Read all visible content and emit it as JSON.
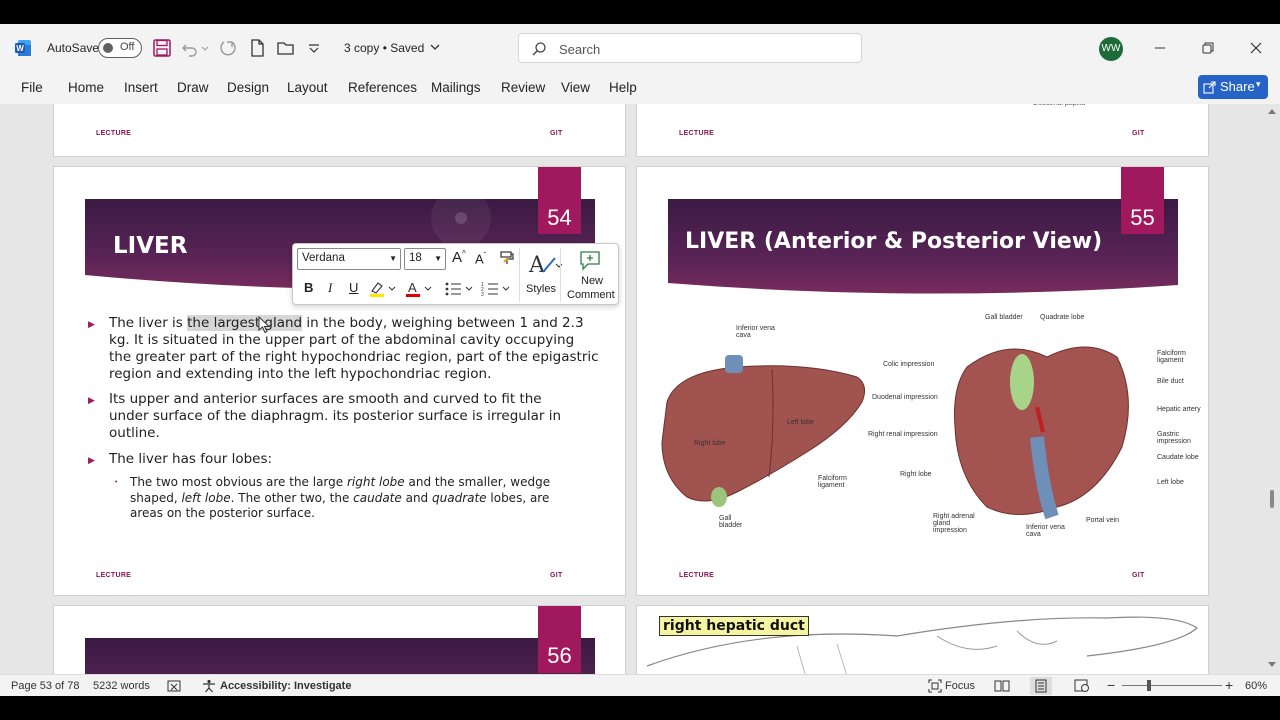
{
  "titlebar": {
    "autosave_label": "AutoSave",
    "autosave_state": "Off",
    "doc_title": "3 copy • Saved",
    "search_placeholder": "Search",
    "user_initials": "WW"
  },
  "menu": {
    "items": [
      "File",
      "Home",
      "Insert",
      "Draw",
      "Design",
      "Layout",
      "References",
      "Mailings",
      "Review",
      "View",
      "Help"
    ],
    "share_label": "Share"
  },
  "pages": {
    "top_left": {
      "footer_left": "LECTURE",
      "footer_right": "GIT"
    },
    "top_right": {
      "footer_left": "LECTURE",
      "footer_right": "GIT"
    },
    "slide54": {
      "number": "54",
      "title": "LIVER",
      "bullets": [
        {
          "pre": "The liver is ",
          "sel": "the largest gland",
          "post": " in the body, weighing between 1 and 2.3 kg. It is situated in the upper part of the abdominal cavity occupying the greater part of the right hypochondriac region, part of the epigastric region and extending into the left hypochondriac region."
        },
        {
          "text": "Its upper and anterior surfaces are smooth and curved to fit the under surface of the diaphragm. its posterior surface is irregular in outline."
        },
        {
          "text": "The liver has four lobes:"
        }
      ],
      "sub_bullet": {
        "p1": "The two most obvious are the large ",
        "i1": "right lobe",
        "p2": " and the smaller, wedge shaped, ",
        "i2": "left lobe",
        "p3": ". The other two, the ",
        "i3": "caudate",
        "p4": " and ",
        "i4": "quadrate",
        "p5": " lobes, are areas on the posterior surface."
      },
      "footer_left": "LECTURE",
      "footer_right": "GIT"
    },
    "slide55": {
      "number": "55",
      "title": "LIVER (Anterior & Posterior View)",
      "labels": {
        "ivc": "Inferior vena cava",
        "left_lobe": "Left lobe",
        "right_lobe": "Right lobe",
        "falciform": "Falciform ligament",
        "gall": "Gall bladder",
        "gall_bladder": "Gall bladder",
        "quadrate": "Quadrate lobe",
        "colic": "Colic impression",
        "duodenal": "Duodenal impression",
        "renal": "Right renal impression",
        "right_lobe2": "Right lobe",
        "adrenal": "Right adrenal gland impression",
        "ivc2": "Inferior vena cava",
        "portal": "Portal vein",
        "falciform2": "Falciform ligament",
        "bile": "Bile duct",
        "hepatic": "Hepatic artery",
        "gastric": "Gastric impression",
        "caudate": "Caudate lobe",
        "left_lobe2": "Left lobe"
      },
      "footer_left": "LECTURE",
      "footer_right": "GIT"
    },
    "slide56": {
      "number": "56"
    },
    "slide57": {
      "label": "right hepatic duct"
    }
  },
  "minitoolbar": {
    "font": "Verdana",
    "size": "18",
    "styles_label": "Styles",
    "new_comment_1": "New",
    "new_comment_2": "Comment",
    "bold": "B",
    "italic": "I",
    "underline": "U"
  },
  "statusbar": {
    "page": "Page 53 of 78",
    "words": "5232 words",
    "accessibility": "Accessibility: Investigate",
    "focus": "Focus",
    "zoom": "60%"
  },
  "colors": {
    "accent": "#a0195e",
    "share": "#2564c6",
    "banner_dark": "#3a1a43"
  }
}
